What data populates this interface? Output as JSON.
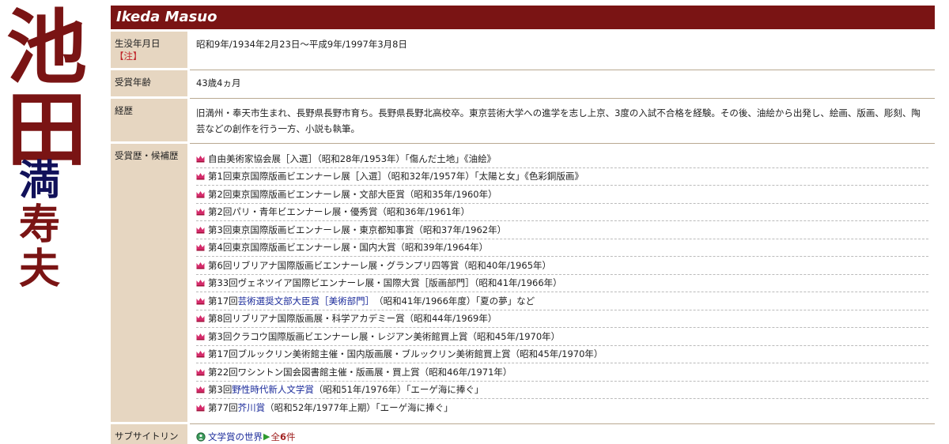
{
  "name_vertical": [
    "池",
    "田",
    "満",
    "寿",
    "夫"
  ],
  "header": {
    "title": "Ikeda Masuo"
  },
  "rows": {
    "birth": {
      "label": "生没年月日",
      "note": "【注】",
      "value": "昭和9年/1934年2月23日〜平成9年/1997年3月8日"
    },
    "age": {
      "label": "受賞年齢",
      "value": "43歳4ヵ月"
    },
    "career": {
      "label": "経歴",
      "value": "旧満州・奉天市生まれ、長野県長野市育ち。長野県長野北高校卒。東京芸術大学への進学を志し上京、3度の入試不合格を経験。その後、油絵から出発し、絵画、版画、彫刻、陶芸などの創作を行う一方、小説も執筆。"
    },
    "awards": {
      "label": "受賞歴・候補歴"
    },
    "sublinks": {
      "label": "サブサイトリンク",
      "link": "文学賞の世界",
      "count_prefix": "全",
      "count_num": "6",
      "count_suffix": "件"
    }
  },
  "awards": [
    {
      "pre": "",
      "link": "",
      "post": "自由美術家協会展［入選］（昭和28年/1953年）「傷んだ土地」《油絵》"
    },
    {
      "pre": "",
      "link": "",
      "post": "第1回東京国際版画ビエンナーレ展［入選］（昭和32年/1957年）「太陽と女」《色彩銅版画》"
    },
    {
      "pre": "",
      "link": "",
      "post": "第2回東京国際版画ビエンナーレ展・文部大臣賞（昭和35年/1960年）"
    },
    {
      "pre": "",
      "link": "",
      "post": "第2回パリ・青年ビエンナーレ展・優秀賞（昭和36年/1961年）"
    },
    {
      "pre": "",
      "link": "",
      "post": "第3回東京国際版画ビエンナーレ展・東京都知事賞（昭和37年/1962年）"
    },
    {
      "pre": "",
      "link": "",
      "post": "第4回東京国際版画ビエンナーレ展・国内大賞（昭和39年/1964年）"
    },
    {
      "pre": "",
      "link": "",
      "post": "第6回リブリアナ国際版画ビエンナーレ展・グランプリ四等賞（昭和40年/1965年）"
    },
    {
      "pre": "",
      "link": "",
      "post": "第33回ヴェネツイア国際ビエンナーレ展・国際大賞［版画部門］（昭和41年/1966年）"
    },
    {
      "pre": "第17回",
      "link": "芸術選奨文部大臣賞［美術部門］",
      "post": "（昭和41年/1966年度）「夏の夢」など"
    },
    {
      "pre": "",
      "link": "",
      "post": "第8回リブリアナ国際版画展・科学アカデミー賞（昭和44年/1969年）"
    },
    {
      "pre": "",
      "link": "",
      "post": "第3回クラコウ国際版画ビエンナーレ展・レジアン美術館買上賞（昭和45年/1970年）"
    },
    {
      "pre": "",
      "link": "",
      "post": "第17回ブルックリン美術館主催・国内版画展・ブルックリン美術館買上賞（昭和45年/1970年）"
    },
    {
      "pre": "",
      "link": "",
      "post": "第22回ワシントン国会図書館主催・版画展・買上賞（昭和46年/1971年）"
    },
    {
      "pre": "第3回",
      "link": "野性時代新人文学賞",
      "post": "（昭和51年/1976年）「エーゲ海に捧ぐ」"
    },
    {
      "pre": "第77回",
      "link": "芥川賞",
      "post": "（昭和52年/1977年上期）「エーゲ海に捧ぐ」"
    }
  ],
  "colors": {
    "header_bg": "#7a1414",
    "label_bg": "#e6d6c1",
    "link": "#1a2a9a",
    "name_red": "#7a1414",
    "name_navy": "#11115a",
    "crown": "#d42a6a"
  }
}
